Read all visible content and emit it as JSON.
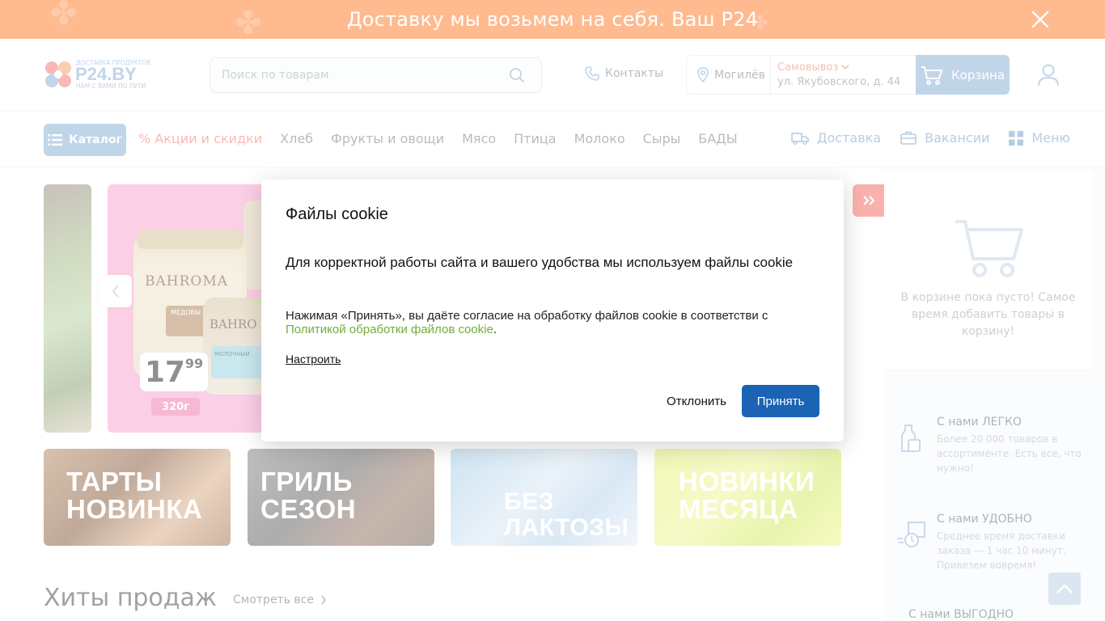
{
  "banner": {
    "text": "Доставку мы возьмем на себя. Ваш Р24"
  },
  "header": {
    "logo_name": "P24.BY",
    "logo_top": "ДОСТАВКА ПРОДУКТОВ",
    "logo_bottom": "НАМ С ВАМИ ПО ПУТИ",
    "search_placeholder": "Поиск по товарам",
    "contacts": "Контакты",
    "city": "Могилёв",
    "pickup": "Самовывоз",
    "address": "ул. Якубовского, д. 44",
    "cart": "Корзина"
  },
  "nav": {
    "catalog": "Каталог",
    "items": [
      "% Акции и скидки",
      "Хлеб",
      "Фрукты и овощи",
      "Мясо",
      "Птица",
      "Молоко",
      "Сыры",
      "БАДЫ"
    ],
    "right": [
      "Доставка",
      "Вакансии",
      "Меню"
    ]
  },
  "slider": {
    "brand": "BAHROMA",
    "sub1": "МЕДОВЫ ГРЕЦКИЙ О",
    "brand2": "BAHRO",
    "sub2": "МОЛОЧНЫЙ",
    "price_int": "17",
    "price_dec": "99",
    "weight": "320г"
  },
  "promos": [
    {
      "line1": "ТАРТЫ",
      "line2": "НОВИНКА"
    },
    {
      "line1": "ГРИЛЬ",
      "line2": "СЕЗОН"
    },
    {
      "line1": "БЕЗ",
      "line2": "ЛАКТОЗЫ"
    },
    {
      "line1": "НОВИНКИ",
      "line2": "МЕСЯЦА"
    }
  ],
  "hits": {
    "title": "Хиты продаж",
    "see_all": "Смотреть все"
  },
  "sidebar": {
    "cart_empty": "В корзине пока пусто! Самое время добавить товары в корзину!",
    "features": [
      {
        "title": "С нами ЛЕГКО",
        "desc": "Более 20 000 товаров в ассортименте. Есть все, что нужно!"
      },
      {
        "title": "С нами УДОБНО",
        "desc": "Среднее время доставки заказа — 1 час 10 минут. Привезем вовремя!"
      },
      {
        "title": "С нами ВЫГОДНО",
        "desc": ""
      }
    ]
  },
  "cookie": {
    "title": "Файлы cookie",
    "lead": "Для корректной работы сайта и вашего удобства мы используем файлы cookie",
    "note_pre": "Нажимая «Принять», вы даёте согласие на обработку файлов cookie в соответстви с",
    "note_link": "Политикой обработки файлов cookie",
    "note_post": ".",
    "configure": "Настроить",
    "decline": "Отклонить",
    "accept": "Принять"
  },
  "colors": {
    "banner": "#ffa36b",
    "accent_blue": "#8fb2d7",
    "promo_red": "#f47d7d",
    "accept_btn": "#1b63b5",
    "link_green": "#6fae3b"
  }
}
